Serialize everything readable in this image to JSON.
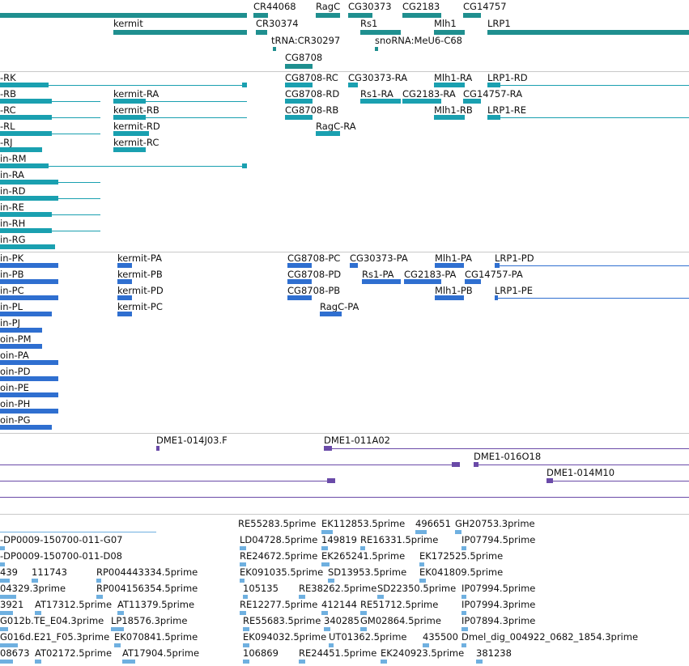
{
  "colors": {
    "gene": "#1f8f8f",
    "gene_light": "#2aa0a8",
    "transcript": "#1aa0b0",
    "protein": "#2f6fd0",
    "clone": "#6a4aa8",
    "est": "#6fb0e0",
    "separator": "#c8c8c8"
  },
  "tracks": [
    {
      "id": "genes",
      "name": "genes-track"
    },
    {
      "id": "transcripts",
      "name": "transcripts-track"
    },
    {
      "id": "proteins",
      "name": "proteins-track"
    },
    {
      "id": "clones",
      "name": "clones-track"
    },
    {
      "id": "ests",
      "name": "ests-track"
    }
  ],
  "genes": [
    {
      "label": "CR44068"
    },
    {
      "label": "RagC"
    },
    {
      "label": "CG30373"
    },
    {
      "label": "CG2183"
    },
    {
      "label": "CG14757"
    },
    {
      "label": "kermit"
    },
    {
      "label": "CR30374"
    },
    {
      "label": "Rs1"
    },
    {
      "label": "Mlh1"
    },
    {
      "label": "LRP1"
    },
    {
      "label": "tRNA:CR30297"
    },
    {
      "label": "snoRNA:MeU6-C68"
    },
    {
      "label": "CG8708"
    }
  ],
  "transcripts": [
    {
      "label": "-RK"
    },
    {
      "label": "CG8708-RC"
    },
    {
      "label": "CG30373-RA"
    },
    {
      "label": "Mlh1-RA"
    },
    {
      "label": "LRP1-RD"
    },
    {
      "label": "-RB"
    },
    {
      "label": "kermit-RA"
    },
    {
      "label": "CG8708-RD"
    },
    {
      "label": "Rs1-RA"
    },
    {
      "label": "CG2183-RA"
    },
    {
      "label": "CG14757-RA"
    },
    {
      "label": "-RC"
    },
    {
      "label": "kermit-RB"
    },
    {
      "label": "CG8708-RB"
    },
    {
      "label": "Mlh1-RB"
    },
    {
      "label": "LRP1-RE"
    },
    {
      "label": "-RL"
    },
    {
      "label": "kermit-RD"
    },
    {
      "label": "RagC-RA"
    },
    {
      "label": "-RJ"
    },
    {
      "label": "kermit-RC"
    },
    {
      "label": "in-RM"
    },
    {
      "label": "in-RA"
    },
    {
      "label": "in-RD"
    },
    {
      "label": "in-RE"
    },
    {
      "label": "in-RH"
    },
    {
      "label": "in-RG"
    }
  ],
  "proteins": [
    {
      "label": "in-PK"
    },
    {
      "label": "kermit-PA"
    },
    {
      "label": "CG8708-PC"
    },
    {
      "label": "CG30373-PA"
    },
    {
      "label": "Mlh1-PA"
    },
    {
      "label": "LRP1-PD"
    },
    {
      "label": "in-PB"
    },
    {
      "label": "kermit-PB"
    },
    {
      "label": "CG8708-PD"
    },
    {
      "label": "Rs1-PA"
    },
    {
      "label": "CG2183-PA"
    },
    {
      "label": "CG14757-PA"
    },
    {
      "label": "in-PC"
    },
    {
      "label": "kermit-PD"
    },
    {
      "label": "CG8708-PB"
    },
    {
      "label": "Mlh1-PB"
    },
    {
      "label": "LRP1-PE"
    },
    {
      "label": "in-PL"
    },
    {
      "label": "kermit-PC"
    },
    {
      "label": "RagC-PA"
    },
    {
      "label": "in-PJ"
    },
    {
      "label": "oin-PM"
    },
    {
      "label": "oin-PA"
    },
    {
      "label": "oin-PD"
    },
    {
      "label": "oin-PE"
    },
    {
      "label": "oin-PH"
    },
    {
      "label": "oin-PG"
    }
  ],
  "clones": [
    {
      "label": "DME1-014J03.F"
    },
    {
      "label": "DME1-011A02"
    },
    {
      "label": "DME1-016O18"
    },
    {
      "label": "DME1-014M10"
    }
  ],
  "ests": [
    {
      "label": "RE55283.5prime"
    },
    {
      "label": "EK112853.5prime"
    },
    {
      "label": "496651"
    },
    {
      "label": "GH20753.3prime"
    },
    {
      "label": "-DP0009-150700-011-G07"
    },
    {
      "label": "LD04728.5prime"
    },
    {
      "label": "149819"
    },
    {
      "label": "RE16331.5prime"
    },
    {
      "label": "IP07794.5prime"
    },
    {
      "label": "-DP0009-150700-011-D08"
    },
    {
      "label": "RE24672.5prime"
    },
    {
      "label": "EK265241.5prime"
    },
    {
      "label": "EK172525.5prime"
    },
    {
      "label": "439"
    },
    {
      "label": "111743"
    },
    {
      "label": "RP004443334.5prime"
    },
    {
      "label": "EK091035.5prime"
    },
    {
      "label": "SD13953.5prime"
    },
    {
      "label": "EK041809.5prime"
    },
    {
      "label": "04329.3prime"
    },
    {
      "label": "RP004156354.5prime"
    },
    {
      "label": "105135"
    },
    {
      "label": "RE38262.5prime"
    },
    {
      "label": "SD22350.5prime"
    },
    {
      "label": "IP07994.5prime"
    },
    {
      "label": "3921"
    },
    {
      "label": "AT17312.5prime"
    },
    {
      "label": "AT11379.5prime"
    },
    {
      "label": "RE12277.5prime"
    },
    {
      "label": "412144"
    },
    {
      "label": "RE51712.5prime"
    },
    {
      "label": "IP07994.3prime"
    },
    {
      "label": "G012b.TE_E04.3prime"
    },
    {
      "label": "LP18576.3prime"
    },
    {
      "label": "RE55683.5prime"
    },
    {
      "label": "340285"
    },
    {
      "label": "GM02864.5prime"
    },
    {
      "label": "IP07894.3prime"
    },
    {
      "label": "G016d.E21_F05.3prime"
    },
    {
      "label": "EK070841.5prime"
    },
    {
      "label": "EK094032.5prime"
    },
    {
      "label": "UT01362.5prime"
    },
    {
      "label": "435500"
    },
    {
      "label": "Dmel_dig_004922_0682_1854.3prime"
    },
    {
      "label": "08673"
    },
    {
      "label": "AT02172.5prime"
    },
    {
      "label": "AT17904.5prime"
    },
    {
      "label": "106869"
    },
    {
      "label": "RE24451.5prime"
    },
    {
      "label": "EK240923.5prime"
    },
    {
      "label": "381238"
    }
  ]
}
